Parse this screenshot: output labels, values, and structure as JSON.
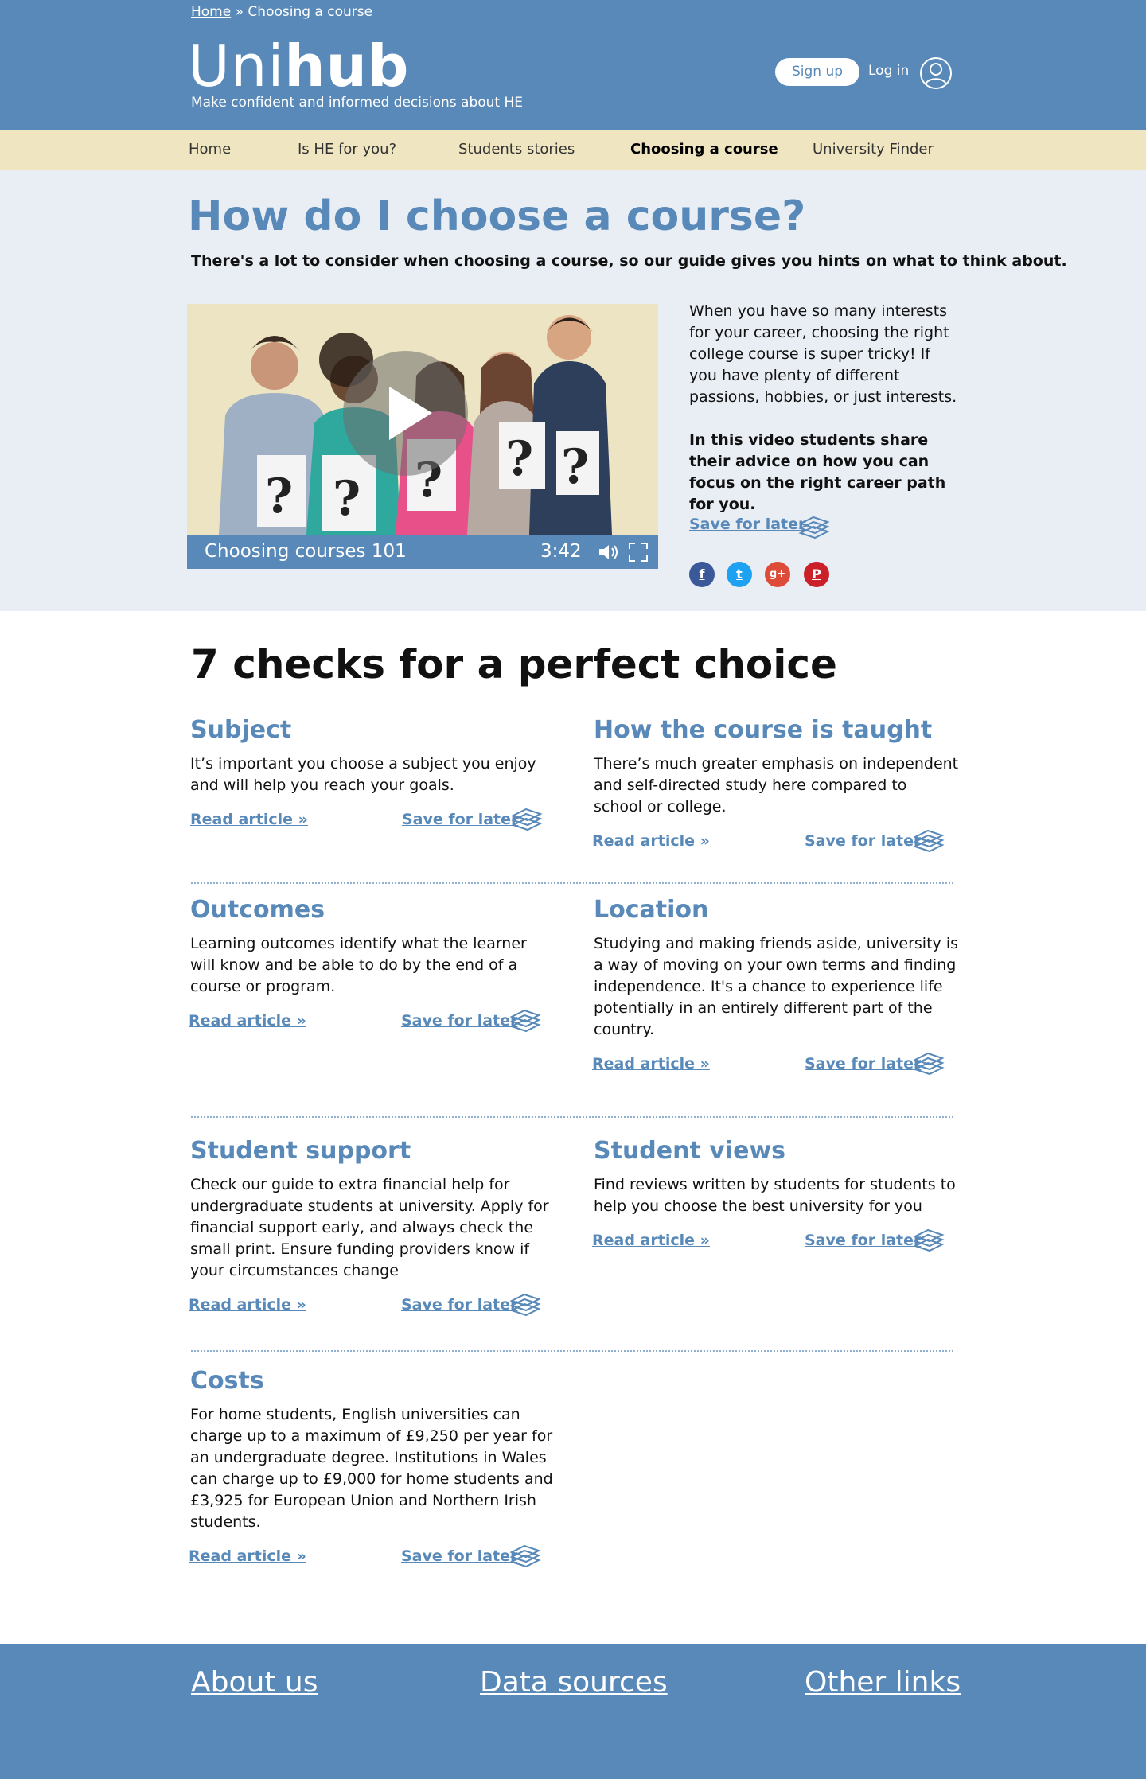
{
  "breadcrumb": {
    "home": "Home",
    "separator": " » ",
    "current": "Choosing a course"
  },
  "brand": {
    "name_light": "Uni",
    "name_bold": "hub",
    "tagline": "Make confident and informed decisions about HE"
  },
  "account": {
    "signup": "Sign up",
    "login": "Log in",
    "user_icon": "user-icon"
  },
  "nav": [
    {
      "label": "Home"
    },
    {
      "label": "Is HE for you?"
    },
    {
      "label": "Students stories"
    },
    {
      "label": "Choosing a course",
      "active": true
    },
    {
      "label": "University Finder"
    }
  ],
  "intro": {
    "title": "How do I choose a course?",
    "lead": "There's a lot to consider when choosing a course, so our guide gives you hints on what to think about.",
    "video": {
      "title": "Choosing courses 101",
      "duration": "3:42"
    },
    "paragraph1": "When you have so many interests for your career, choosing the right college course is super tricky! If you have plenty of different passions, hobbies, or just interests.",
    "paragraph2": "In this video students share their advice on how you can focus on the right career path for you.",
    "save": "Save for later",
    "social": [
      {
        "name": "facebook",
        "glyph": "f",
        "color": "#3b5998"
      },
      {
        "name": "twitter",
        "glyph": "t",
        "color": "#1da1f2"
      },
      {
        "name": "google-plus",
        "glyph": "g+",
        "color": "#dd4b39"
      },
      {
        "name": "pinterest",
        "glyph": "P",
        "color": "#cb2027"
      }
    ]
  },
  "checks": {
    "title": "7 checks for a perfect choice",
    "read_label": "Read article »",
    "save_label": "Save for later",
    "cards": [
      {
        "title": "Subject",
        "text": "It’s important you choose a subject you enjoy and will help you reach your goals."
      },
      {
        "title": "How the course is taught",
        "text": "There’s much greater emphasis on independent and self-directed study here compared to school or college."
      },
      {
        "title": "Outcomes",
        "text": "Learning outcomes identify what the learner will know and be able to do by the end of a course or program."
      },
      {
        "title": "Location",
        "text": "Studying and making friends aside, university is a way of moving on your own terms and finding independence. It's a chance to experience life potentially in an entirely different part of the country."
      },
      {
        "title": "Student support",
        "text": "Check our guide to extra financial help for undergraduate students at university. Apply for financial support early, and always check the small print. Ensure funding providers know if your circumstances change"
      },
      {
        "title": "Student views",
        "text": "Find reviews written by students for students to help you choose the best university for you"
      },
      {
        "title": "Costs",
        "text": "For home students, English universities can charge up to a maximum of £9,250 per year for an undergraduate degree. Institutions in Wales can charge up to £9,000 for home students and £3,925 for European Union and Northern Irish students."
      }
    ]
  },
  "footer": {
    "links": [
      "About us",
      "Data sources",
      "Other links"
    ]
  },
  "colors": {
    "primary": "#5889b8",
    "nav_bg": "#efe6c1",
    "intro_bg": "#e9eef5"
  }
}
